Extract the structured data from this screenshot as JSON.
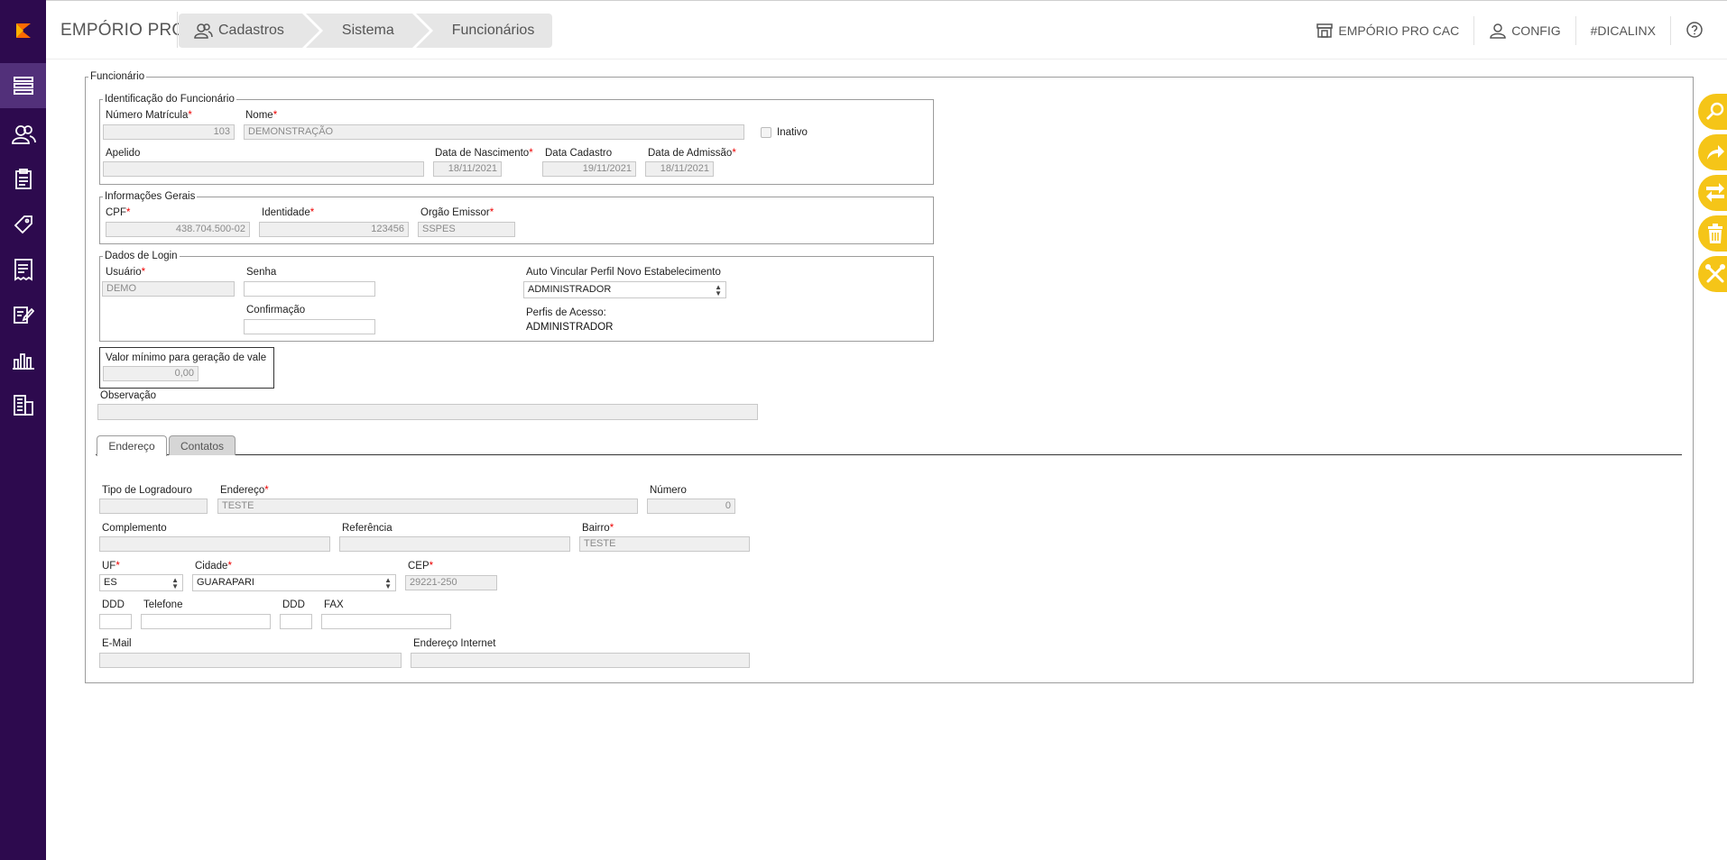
{
  "app": {
    "title": "EMPÓRIO PRO"
  },
  "breadcrumb": [
    {
      "label": "Cadastros"
    },
    {
      "label": "Sistema"
    },
    {
      "label": "Funcionários"
    }
  ],
  "top_right": {
    "cac": "EMPÓRIO PRO CAC",
    "config": "CONFIG",
    "dicalinx": "#DICALINX"
  },
  "colors": {
    "sidebar": "#2d0a4e",
    "sidebar_active": "#52307a",
    "accent": "#f5c518",
    "logo": "#ff6a00",
    "required": "#ee0000"
  },
  "form": {
    "legend": "Funcionário",
    "identificacao": {
      "legend": "Identificação do Funcionário",
      "matricula_label": "Número Matrícula",
      "matricula_value": "103",
      "nome_label": "Nome",
      "nome_value": "DEMONSTRAÇÃO",
      "inativo_label": "Inativo",
      "apelido_label": "Apelido",
      "apelido_value": "",
      "nascimento_label": "Data de Nascimento",
      "nascimento_value": "18/11/2021",
      "cadastro_label": "Data Cadastro",
      "cadastro_value": "19/11/2021",
      "admissao_label": "Data de Admissão",
      "admissao_value": "18/11/2021"
    },
    "gerais": {
      "legend": "Informações Gerais",
      "cpf_label": "CPF",
      "cpf_value": "438.704.500-02",
      "identidade_label": "Identidade",
      "identidade_value": "123456",
      "orgao_label": "Orgão Emissor",
      "orgao_value": "SSPES"
    },
    "login": {
      "legend": "Dados de Login",
      "usuario_label": "Usuário",
      "usuario_value": "DEMO",
      "senha_label": "Senha",
      "confirmacao_label": "Confirmação",
      "perfil_label": "Auto Vincular Perfil Novo Estabelecimento",
      "perfil_value": "ADMINISTRADOR",
      "perfis_label": "Perfis de Acesso:",
      "perfis_value": "ADMINISTRADOR"
    },
    "vale": {
      "legend": "Valor mínimo para geração de vale",
      "value": "0,00"
    },
    "observacao_label": "Observação"
  },
  "tabs": [
    {
      "label": "Endereço",
      "active": true
    },
    {
      "label": "Contatos",
      "active": false
    }
  ],
  "endereco": {
    "tipo_label": "Tipo de Logradouro",
    "endereco_label": "Endereço",
    "endereco_value": "TESTE",
    "numero_label": "Número",
    "numero_value": "0",
    "complemento_label": "Complemento",
    "referencia_label": "Referência",
    "bairro_label": "Bairro",
    "bairro_value": "TESTE",
    "uf_label": "UF",
    "uf_value": "ES",
    "cidade_label": "Cidade",
    "cidade_value": "GUARAPARI",
    "cep_label": "CEP",
    "cep_value": "29221-250",
    "ddd_label": "DDD",
    "telefone_label": "Telefone",
    "ddd2_label": "DDD",
    "fax_label": "FAX",
    "email_label": "E-Mail",
    "internet_label": "Endereço Internet"
  }
}
